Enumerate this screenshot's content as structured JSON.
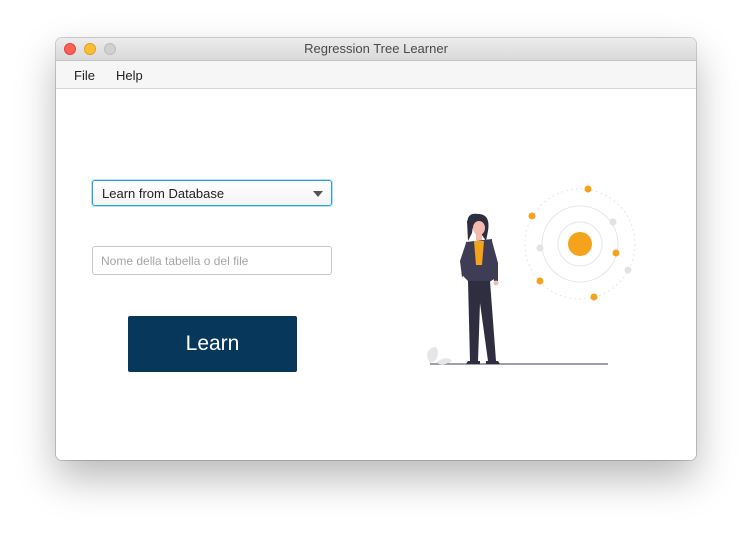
{
  "window": {
    "title": "Regression Tree Learner"
  },
  "menu": {
    "items": [
      {
        "label": "File"
      },
      {
        "label": "Help"
      }
    ]
  },
  "form": {
    "source_select": {
      "value": "Learn from Database"
    },
    "table_input": {
      "placeholder": "Nome della tabella o del file",
      "value": ""
    },
    "learn_button": {
      "label": "Learn"
    }
  },
  "colors": {
    "accent": "#07385c",
    "focus": "#2aa0e0",
    "illustration_orange": "#f5a31a"
  },
  "icons": [
    "close-window-icon",
    "minimize-window-icon",
    "zoom-window-icon",
    "dropdown-arrow-icon"
  ]
}
